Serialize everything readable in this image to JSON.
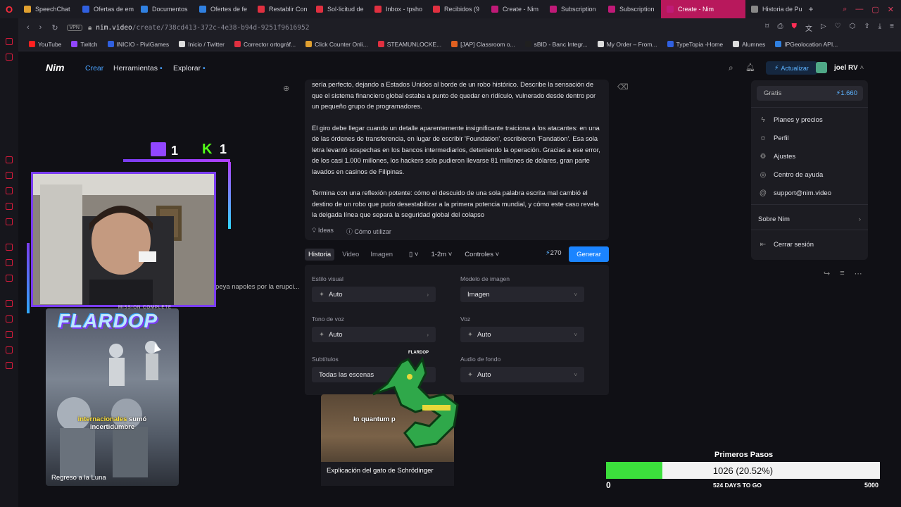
{
  "browser": {
    "tabs": [
      {
        "label": "SpeechChat",
        "color": "#e0a030"
      },
      {
        "label": "Ofertas de em",
        "color": "#3060e0"
      },
      {
        "label": "Documentos",
        "color": "#3080e0"
      },
      {
        "label": "Ofertes de fe",
        "color": "#3080e0"
      },
      {
        "label": "Restablir Con",
        "color": "#e03040"
      },
      {
        "label": "Sol·licitud de",
        "color": "#e03040"
      },
      {
        "label": "Inbox - tpsho",
        "color": "#e03040"
      },
      {
        "label": "Recibidos (9",
        "color": "#e03040"
      },
      {
        "label": "Create - Nim",
        "color": "#c01a78"
      },
      {
        "label": "Subscription",
        "color": "#c01a78"
      },
      {
        "label": "Subscription",
        "color": "#c01a78"
      },
      {
        "label": "Create - Nim",
        "color": "#c01a78",
        "active": true
      },
      {
        "label": "Historia de Pu",
        "color": "#888888"
      }
    ],
    "new_tab": "+",
    "url_host": "nim.video",
    "url_path": "/create/738cd413-372c-4e38-b94d-9251f9616952",
    "vpn_badge": "VPN",
    "bookmarks": [
      {
        "label": "YouTube",
        "color": "#ff2020"
      },
      {
        "label": "Twitch",
        "color": "#9146ff"
      },
      {
        "label": "INICIO - PiviGames",
        "color": "#3060e0"
      },
      {
        "label": "Inicio / Twitter",
        "color": "#dddddd"
      },
      {
        "label": "Corrector ortográf...",
        "color": "#e03040"
      },
      {
        "label": "Click Counter Onli...",
        "color": "#e0a030"
      },
      {
        "label": "STEAMUNLOCKE...",
        "color": "#e03040"
      },
      {
        "label": "[JAP] Classroom o...",
        "color": "#e06020"
      },
      {
        "label": "sBID - Banc Integr...",
        "color": "#202020"
      },
      {
        "label": "My Order – From...",
        "color": "#dddddd"
      },
      {
        "label": "TypeTopia -Home",
        "color": "#3060e0"
      },
      {
        "label": "Alumnes",
        "color": "#dddddd"
      },
      {
        "label": "IPGeolocation API...",
        "color": "#3080e0"
      }
    ]
  },
  "nav": {
    "logo": "Nim",
    "links": {
      "create": "Crear",
      "tools": "Herramientas",
      "explore": "Explorar"
    },
    "upgrade": "Actualizar",
    "username": "joel RV"
  },
  "prompt": {
    "paragraphs": [
      "sería perfecto, dejando a Estados Unidos al borde de un robo histórico. Describe la sensación de que el sistema financiero global estaba a punto de quedar en ridículo, vulnerado desde dentro por un pequeño grupo de programadores.",
      "El giro debe llegar cuando un detalle aparentemente insignificante traiciona a los atacantes: en una de las órdenes de transferencia, en lugar de escribir 'Foundation', escribieron 'Fandation'. Esa sola letra levantó sospechas en los bancos intermediarios, deteniendo la operación. Gracias a ese error, de los casi 1.000 millones, los hackers solo pudieron llevarse 81 millones de dólares, gran parte lavados en casinos de Filipinas.",
      "Termina con una reflexión potente: cómo el descuido de una sola palabra escrita mal cambió el destino de un robo que pudo desestabilizar a la primera potencia mundial, y cómo este caso revela la delgada línea que separa la seguridad global del colapso"
    ],
    "ideas": "Ideas",
    "how_to": "Cómo utilizar"
  },
  "toolbar": {
    "tabs": [
      "Historia",
      "Video",
      "Imagen"
    ],
    "duration": "1-2m",
    "controls": "Controles",
    "credits": "270",
    "generate": "Generar"
  },
  "settings": {
    "visual_style": {
      "label": "Estilo visual",
      "value": "Auto"
    },
    "image_model": {
      "label": "Modelo de imagen",
      "value": "Imagen"
    },
    "voice_tone": {
      "label": "Tono de voz",
      "value": "Auto"
    },
    "voice": {
      "label": "Voz",
      "value": "Auto"
    },
    "subtitles": {
      "label": "Subtítulos",
      "value": "Todas las escenas"
    },
    "background_audio": {
      "label": "Audio de fondo",
      "value": "Auto"
    }
  },
  "menu": {
    "plan": "Gratis",
    "plan_credits": "1.660",
    "items": {
      "plans": "Planes y precios",
      "profile": "Perfil",
      "settings": "Ajustes",
      "help": "Centro de ayuda",
      "support": "support@nim.video",
      "about": "Sobre Nim",
      "logout": "Cerrar sesión"
    }
  },
  "videos": {
    "truncated_title": "peya napoles por la erupci...",
    "moon_caption": "Regreso a la Luna",
    "moon_sub_hl": "internacionales",
    "moon_sub_rest": "sumó",
    "moon_sub_line2": "incertidumbre",
    "cat_caption": "Explicación del gato de Schrödinger",
    "cat_sub": "In quantum p"
  },
  "stream": {
    "twitch_count": "1",
    "kick_count": "1",
    "brand": "FLARDOP",
    "mission": "MISSION COMPLETE",
    "sprite_label": "FLARDOP"
  },
  "goal": {
    "title": "Primeros Pasos",
    "current": 1026,
    "text": "1026 (20.52%)",
    "fraction": 0.2052,
    "min": "0",
    "days_left": "524 DAYS TO GO",
    "max": "5000"
  }
}
